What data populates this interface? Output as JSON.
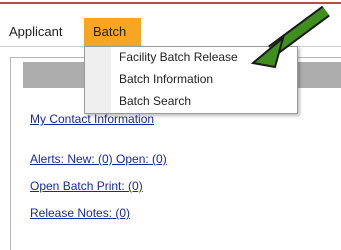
{
  "menubar": {
    "items": [
      {
        "label": "Applicant"
      },
      {
        "label": "Batch"
      }
    ]
  },
  "dropdown": {
    "items": [
      {
        "label": "Facility Batch Release"
      },
      {
        "label": "Batch Information"
      },
      {
        "label": "Batch Search"
      }
    ]
  },
  "panel": {
    "links": [
      {
        "label": "My Contact Information"
      },
      {
        "label": "Alerts: New: (0)   Open: (0)"
      },
      {
        "label": "Open Batch Print: (0)"
      },
      {
        "label": "Release Notes: (0)"
      }
    ]
  },
  "colors": {
    "batch_active_bg": "#f6a623",
    "arrow_green": "#3f8f1f",
    "link_blue": "#1a27a6"
  },
  "icons": {
    "pointer": "arrow-icon"
  }
}
